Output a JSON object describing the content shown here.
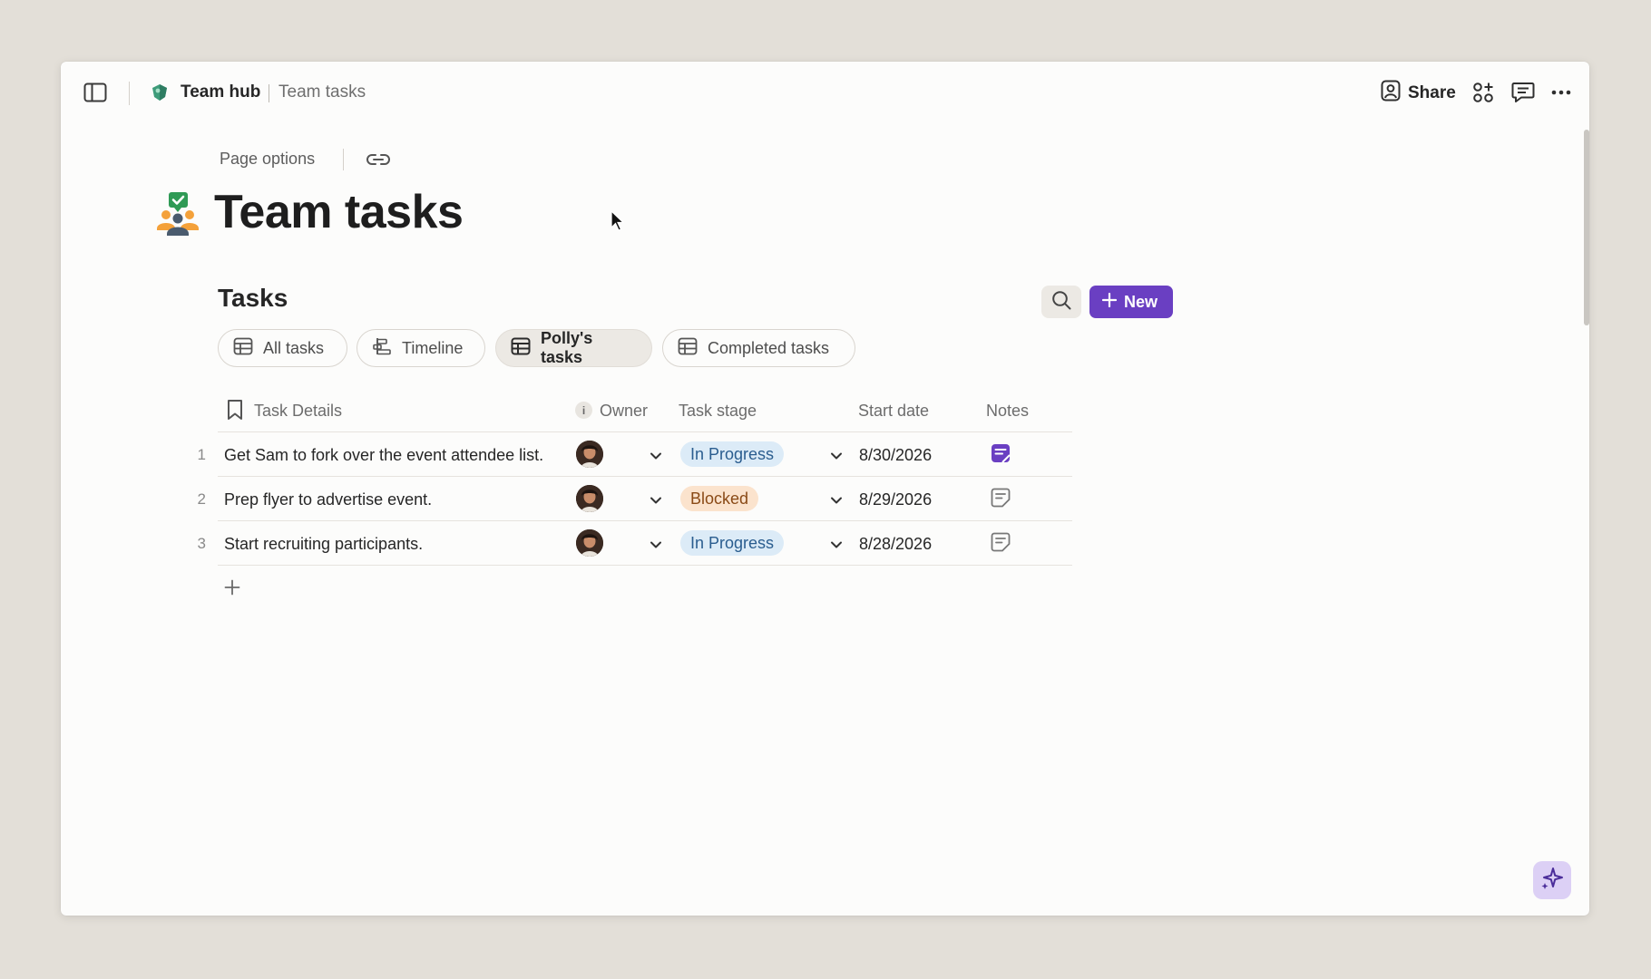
{
  "topbar": {
    "breadcrumb_workspace": "Team hub",
    "breadcrumb_page": "Team tasks",
    "share_label": "Share",
    "icons": [
      "sidebar-toggle-icon",
      "team-hub-logo-icon",
      "share-person-icon",
      "apps-grid-icon",
      "comment-icon",
      "more-icon"
    ]
  },
  "page": {
    "options_label": "Page options",
    "title": "Team tasks",
    "icon": "team-tasks-icon"
  },
  "tasks_section": {
    "title": "Tasks",
    "new_button_label": "New",
    "tabs": [
      {
        "label": "All tasks",
        "icon": "table-icon",
        "active": false
      },
      {
        "label": "Timeline",
        "icon": "timeline-icon",
        "active": false
      },
      {
        "label": "Polly's tasks",
        "icon": "table-icon",
        "active": true
      },
      {
        "label": "Completed tasks",
        "icon": "table-icon",
        "active": false
      }
    ],
    "columns": {
      "task_details": "Task Details",
      "owner": "Owner",
      "task_stage": "Task stage",
      "start_date": "Start date",
      "notes": "Notes"
    },
    "rows": [
      {
        "num": "1",
        "task": "Get Sam to fork over the event attendee list.",
        "stage": "In Progress",
        "date": "8/30/2026",
        "has_note": true
      },
      {
        "num": "2",
        "task": "Prep flyer to advertise event.",
        "stage": "Blocked",
        "date": "8/29/2026",
        "has_note": false
      },
      {
        "num": "3",
        "task": "Start recruiting participants.",
        "stage": "In Progress",
        "date": "8/28/2026",
        "has_note": false
      }
    ]
  },
  "colors": {
    "accent": "#6a3fc2",
    "in_progress_bg": "#dcebf7",
    "blocked_bg": "#fbe3cd"
  }
}
